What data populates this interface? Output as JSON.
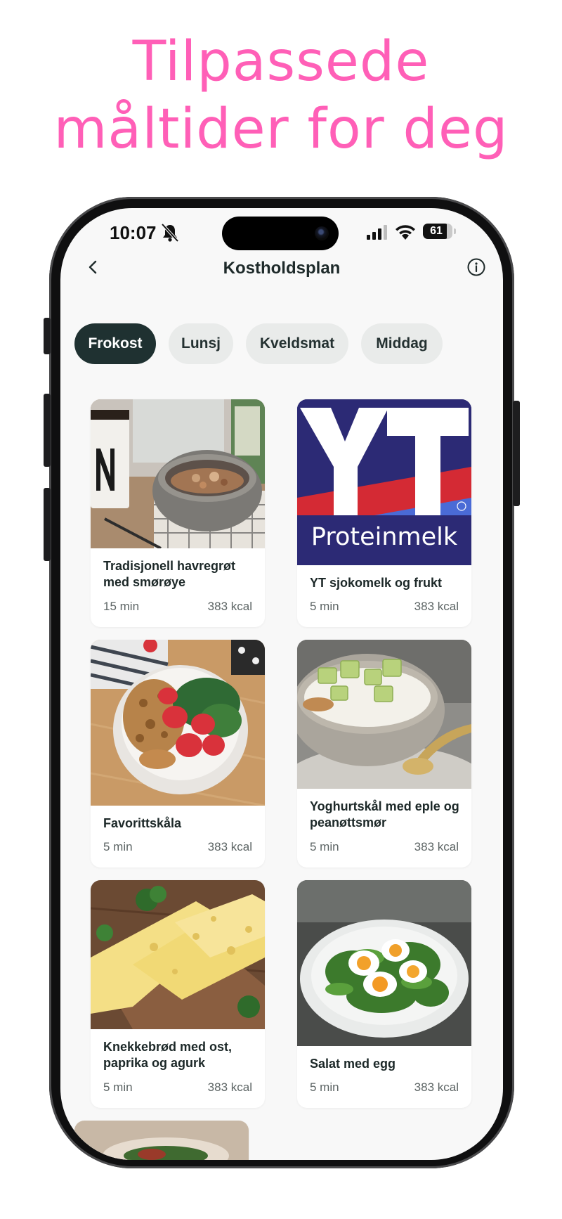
{
  "headline": {
    "line1": "Tilpassede",
    "line2": "måltider for deg"
  },
  "status_bar": {
    "time": "10:07",
    "battery": "61"
  },
  "nav": {
    "title": "Kostholdsplan"
  },
  "tabs": [
    {
      "label": "Frokost",
      "active": true
    },
    {
      "label": "Lunsj",
      "active": false
    },
    {
      "label": "Kveldsmat",
      "active": false
    },
    {
      "label": "Middag",
      "active": false
    }
  ],
  "meals": [
    {
      "title": "Tradisjonell havregrøt med smørøye",
      "time": "15 min",
      "kcal": "383 kcal"
    },
    {
      "title": "YT sjokomelk og frukt",
      "time": "5 min",
      "kcal": "383 kcal",
      "logo_text": "Proteinmelk"
    },
    {
      "title": "Favorittskåla",
      "time": "5 min",
      "kcal": "383 kcal"
    },
    {
      "title": "Yoghurtskål med eple og peanøttsmør",
      "time": "5 min",
      "kcal": "383 kcal"
    },
    {
      "title": "Knekkebrød med ost, paprika og agurk",
      "time": "5 min",
      "kcal": "383 kcal"
    },
    {
      "title": "Salat med egg",
      "time": "5 min",
      "kcal": "383 kcal"
    }
  ],
  "colors": {
    "headline": "#ff5fb7",
    "active_tab": "#1f3131",
    "inactive_tab": "#e9ebea",
    "screen_bg": "#f8f8f8"
  },
  "icons": [
    "back-chevron-icon",
    "info-icon",
    "bell-muted-icon",
    "signal-icon",
    "wifi-icon",
    "battery-icon"
  ]
}
